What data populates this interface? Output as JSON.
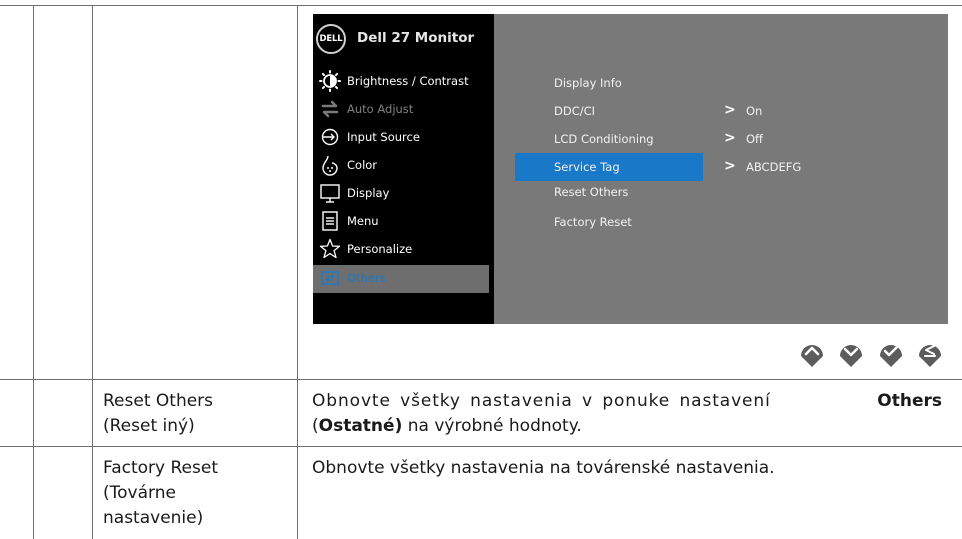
{
  "osd": {
    "brand": "DELL",
    "title": "Dell 27 Monitor",
    "menu_items": [
      {
        "label": "Brightness / Contrast",
        "icon": "brightness-icon"
      },
      {
        "label": "Auto Adjust",
        "icon": "auto-adjust-icon"
      },
      {
        "label": "Input Source",
        "icon": "input-source-icon"
      },
      {
        "label": "Color",
        "icon": "color-icon"
      },
      {
        "label": "Display",
        "icon": "display-icon"
      },
      {
        "label": "Menu",
        "icon": "menu-icon"
      },
      {
        "label": "Personalize",
        "icon": "star-icon"
      },
      {
        "label": "Others",
        "icon": "others-icon"
      }
    ],
    "active_item": "Others",
    "sub_items": [
      "Display Info",
      "DDC/CI",
      "LCD Conditioning",
      "Service Tag",
      "Reset Others",
      "Factory Reset"
    ],
    "selected_sub_item": "Service Tag",
    "values": {
      "ddc_ci": "On",
      "lcd_conditioning": "Off",
      "service_tag": "ABCDEFG"
    },
    "chevron": ">",
    "nav_buttons": [
      "up-icon",
      "down-icon",
      "check-icon",
      "back-icon"
    ],
    "colors": {
      "highlight": "#1978c8",
      "panel": "#797979",
      "menu_bg": "#000000"
    }
  },
  "rows": [
    {
      "name_line1": "Reset Others",
      "name_line2": "(Reset iný)",
      "desc_line1_pre": "Obnovte všetky nastavenia v ponuke nastavení ",
      "desc_line1_bold": "Others",
      "desc_line2_open": "(",
      "desc_line2_bold": "Ostatné)",
      "desc_line2_post": " na výrobné hodnoty."
    },
    {
      "name_line1": "Factory Reset",
      "name_line2": "(Továrne",
      "name_line3": "nastavenie)",
      "desc": "Obnovte všetky nastavenia na továrenské nastavenia."
    }
  ]
}
